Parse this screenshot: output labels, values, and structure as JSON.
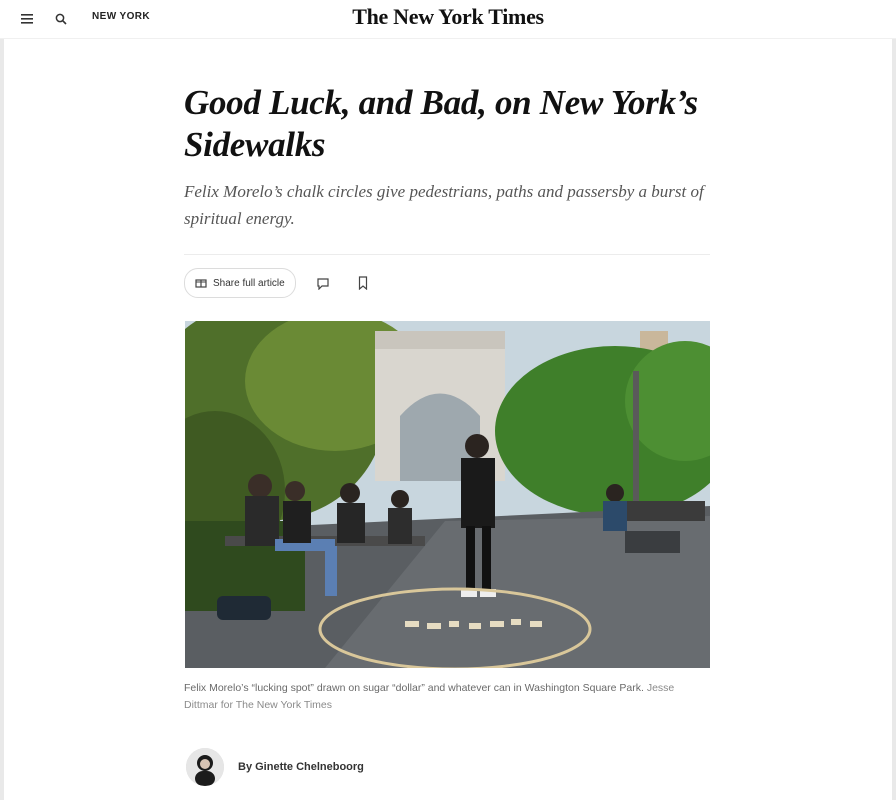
{
  "header": {
    "menu_icon": "hamburger-icon",
    "search_icon": "search-icon",
    "section_label": "NEW YORK",
    "masthead": "The New York Times"
  },
  "article": {
    "headline": "Good Luck, and Bad, on New York’s Sidewalks",
    "dek": "Felix Morelo’s chalk circles give pedestrians, paths and passersby a burst of spiritual energy.",
    "tools": {
      "share_label": "Share full article",
      "share_icon": "gift-icon",
      "comments_icon": "comment-icon",
      "save_icon": "bookmark-icon"
    },
    "photo": {
      "alt": "People in a park under a stone arch"
    },
    "caption": {
      "text": "Felix Morelo’s “lucking spot” drawn on sugar “dollar” and whatever can in Washington Square Park.",
      "credit": "Jesse Dittmar for The New York Times"
    },
    "byline": {
      "text": "By Ginette Chelneboorg"
    }
  },
  "colors": {
    "text": "#121212",
    "muted": "#555555",
    "border": "#dcdcdc"
  }
}
